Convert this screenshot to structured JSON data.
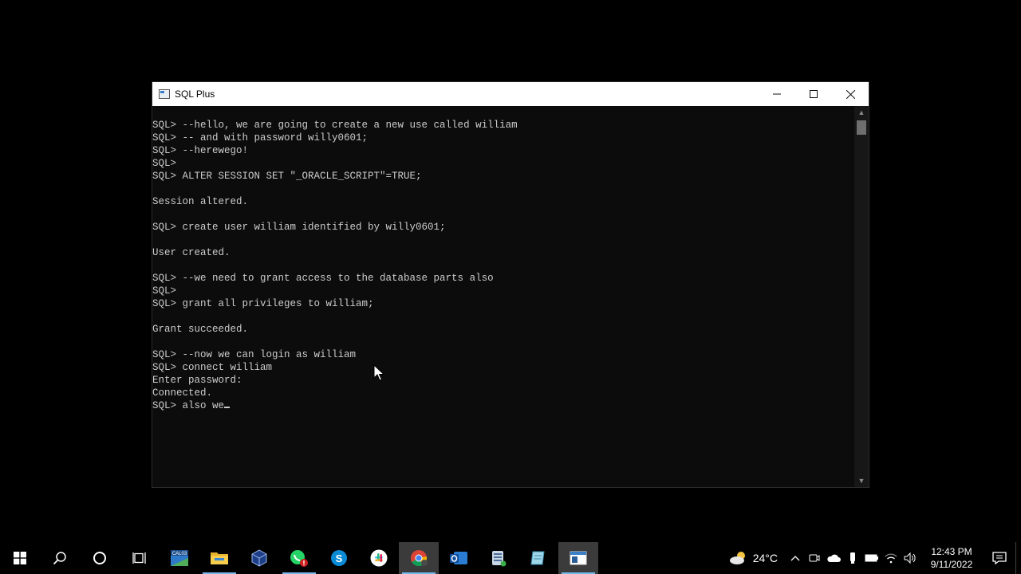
{
  "window": {
    "title": "SQL Plus",
    "controls": {
      "minimize": "—",
      "maximize": "☐",
      "close": "✕"
    }
  },
  "console": {
    "lines": [
      "SQL> --hello, we are going to create a new use called william",
      "SQL> -- and with password willy0601;",
      "SQL> --herewego!",
      "SQL>",
      "SQL> ALTER SESSION SET \"_ORACLE_SCRIPT\"=TRUE;",
      "",
      "Session altered.",
      "",
      "SQL> create user william identified by willy0601;",
      "",
      "User created.",
      "",
      "SQL> --we need to grant access to the database parts also",
      "SQL>",
      "SQL> grant all privileges to william;",
      "",
      "Grant succeeded.",
      "",
      "SQL> --now we can login as william",
      "SQL> connect william",
      "Enter password:",
      "Connected.",
      "SQL> also we"
    ]
  },
  "taskbar": {
    "items": [
      {
        "name": "start-button",
        "icon": "windows-logo-icon"
      },
      {
        "name": "search-button",
        "icon": "search-icon"
      },
      {
        "name": "cortana-button",
        "icon": "cortana-icon"
      },
      {
        "name": "task-view-button",
        "icon": "task-view-icon"
      },
      {
        "name": "calendar-app",
        "icon": "calendar-icon",
        "label": "CAL03"
      },
      {
        "name": "file-explorer",
        "icon": "folder-icon"
      },
      {
        "name": "virtualbox-app",
        "icon": "cube-icon"
      },
      {
        "name": "whatsapp-app",
        "icon": "whatsapp-icon"
      },
      {
        "name": "skype-app",
        "icon": "skype-icon",
        "label": "S"
      },
      {
        "name": "slack-app",
        "icon": "slack-icon"
      },
      {
        "name": "chrome-app",
        "icon": "chrome-icon"
      },
      {
        "name": "outlook-app",
        "icon": "mail-icon"
      },
      {
        "name": "database-app",
        "icon": "database-icon"
      },
      {
        "name": "notes-app",
        "icon": "notes-icon"
      },
      {
        "name": "sqlplus-app",
        "icon": "console-icon"
      }
    ],
    "tray": {
      "temperature": "24°C",
      "time": "12:43 PM",
      "date": "9/11/2022"
    }
  },
  "colors": {
    "console_bg": "#0c0c0c",
    "console_text": "#cccccc",
    "taskbar_accent": "#76b9ed"
  }
}
